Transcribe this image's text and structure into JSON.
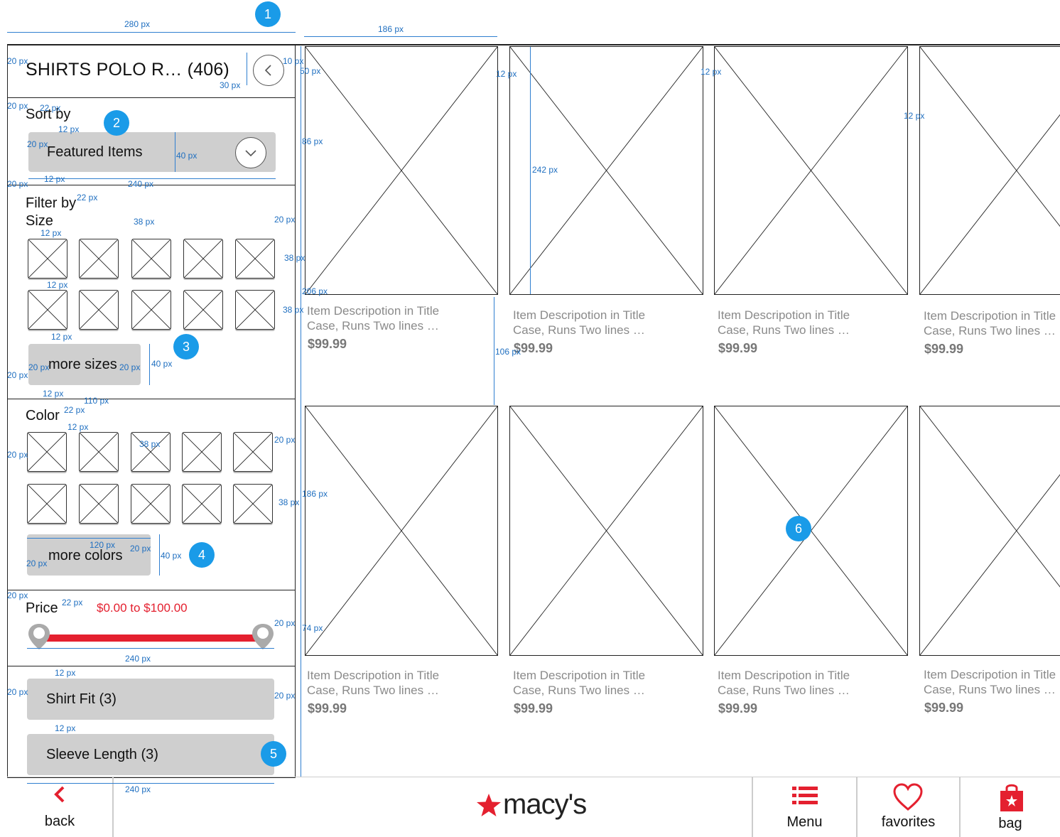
{
  "header": {
    "title": "SHIRTS POLO R… (406)",
    "back_circle_icon": "chevron-left-icon"
  },
  "sort": {
    "label": "Sort by",
    "selected": "Featured Items"
  },
  "filter": {
    "label": "Filter by",
    "size_label": "Size",
    "more_sizes": "more sizes",
    "color_label": "Color",
    "more_colors": "more colors",
    "price_label": "Price",
    "price_range": "$0.00 to $100.00",
    "price_min": 0,
    "price_max": 100,
    "shirt_fit": "Shirt Fit (3)",
    "sleeve_length": "Sleeve Length (3)"
  },
  "products": [
    {
      "desc1": "Item Descripotion in Title",
      "desc2": "Case, Runs Two lines …",
      "price": "$99.99"
    },
    {
      "desc1": "Item Descripotion in Title",
      "desc2": "Case, Runs Two lines …",
      "price": "$99.99"
    },
    {
      "desc1": "Item Descripotion in Title",
      "desc2": "Case, Runs Two lines …",
      "price": "$99.99"
    },
    {
      "desc1": "Item Descripotion in Title",
      "desc2": "Case, Runs Two lines …",
      "price": "$99.99"
    },
    {
      "desc1": "Item Descripotion in Title",
      "desc2": "Case, Runs Two lines …",
      "price": "$99.99"
    },
    {
      "desc1": "Item Descripotion in Title",
      "desc2": "Case, Runs Two lines …",
      "price": "$99.99"
    },
    {
      "desc1": "Item Descripotion in Title",
      "desc2": "Case, Runs Two lines …",
      "price": "$99.99"
    },
    {
      "desc1": "Item Descripotion in Title",
      "desc2": "Case, Runs Two lines …",
      "price": "$99.99"
    }
  ],
  "footer": {
    "back": "back",
    "logo": "macy's",
    "menu": "Menu",
    "favorites": "favorites",
    "bag": "bag"
  },
  "badges": [
    "1",
    "2",
    "3",
    "4",
    "5",
    "6"
  ],
  "dims": {
    "d280": "280 px",
    "d186": "186 px",
    "d20": "20 px",
    "d10": "10 px",
    "d30": "30 px",
    "d50": "50 px",
    "d22": "22 px",
    "d12": "12 px",
    "d40": "40 px",
    "d240": "240 px",
    "d86": "86 px",
    "d242": "242 px",
    "d38": "38 px",
    "d206": "206 px",
    "d106": "106 px",
    "d110": "110 px",
    "d120": "120 px",
    "d74": "74 px"
  },
  "colors": {
    "accent_red": "#e4202f",
    "annotation_blue": "#1f6fc0",
    "badge_blue": "#1a9be8",
    "button_gray": "#cfcfcf"
  }
}
